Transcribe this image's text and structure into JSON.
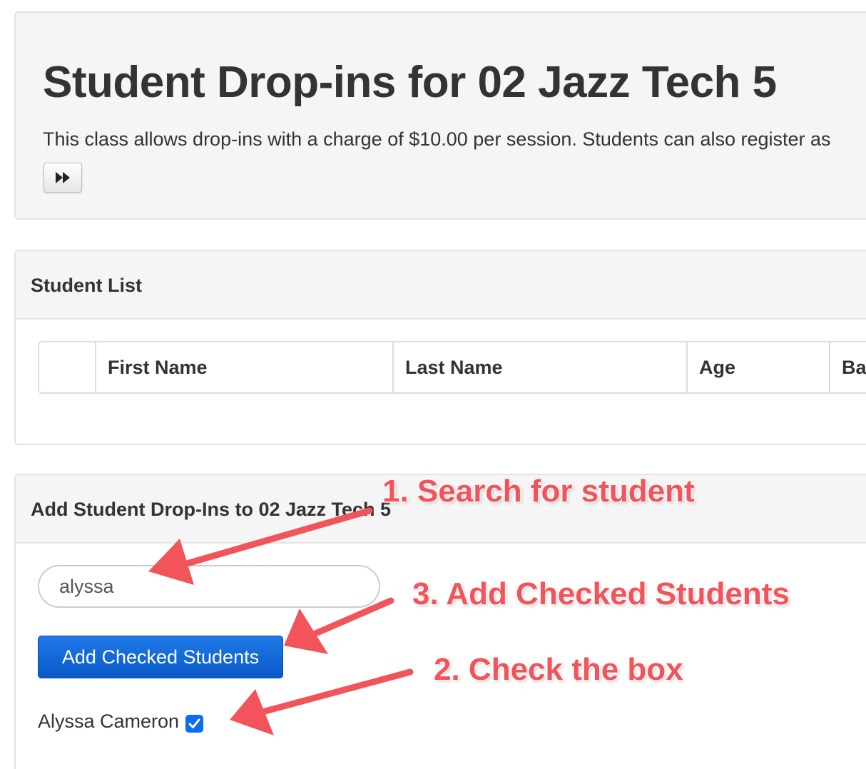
{
  "hero": {
    "title": "Student Drop-ins for 02 Jazz Tech 5",
    "description": "This class allows drop-ins with a charge of $10.00 per session. Students can also register as"
  },
  "student_list": {
    "title": "Student List",
    "columns": [
      "",
      "First Name",
      "Last Name",
      "Age",
      "Ba"
    ]
  },
  "add_panel": {
    "title": "Add Student Drop-Ins to 02 Jazz Tech 5",
    "search_value": "alyssa",
    "add_button_label": "Add Checked Students",
    "student_name": "Alyssa Cameron",
    "student_checked": true
  },
  "annotations": [
    {
      "label": "1. Search for student"
    },
    {
      "label": "3. Add Checked Students"
    },
    {
      "label": "2. Check the box"
    }
  ],
  "colors": {
    "annotation": "#f2545b",
    "primary_button": "#0a58c8",
    "checkbox": "#0a6cf0"
  }
}
